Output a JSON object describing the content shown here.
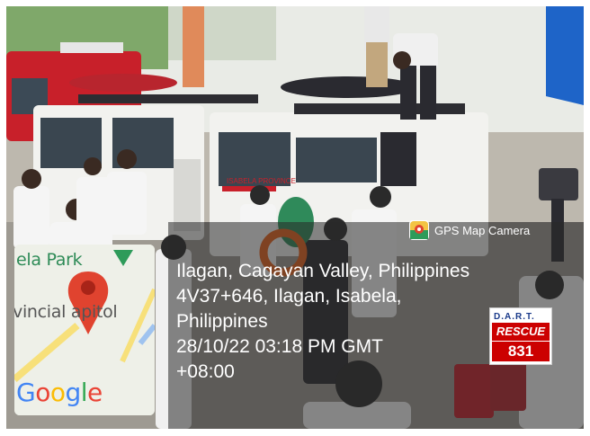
{
  "map": {
    "label_park": "ela Park",
    "label_capitol": "vincial apitol",
    "logo": "Google"
  },
  "overlay": {
    "app_name": "GPS Map Camera",
    "app_icon": "gps-map-camera-icon",
    "location_lines": [
      "Ilagan, Cagayan Valley, Philippines",
      "4V37+646, Ilagan, Isabela,",
      "Philippines",
      "28/10/22 03:18 PM GMT",
      "+08:00"
    ]
  },
  "badge": {
    "top": "D.A.R.T.",
    "middle": "RESCUE",
    "number": "831"
  },
  "scene": {
    "van_side_text": "ISABELA PROVINCE",
    "colors": {
      "fire_truck": "#c8202a",
      "van": "#f2f2ef",
      "uniform_dark": "#2a2a30",
      "flag_blue": "#1e64c8",
      "life_ring": "#e8621c",
      "overlay_bg": "rgba(40,40,40,0.55)"
    }
  }
}
